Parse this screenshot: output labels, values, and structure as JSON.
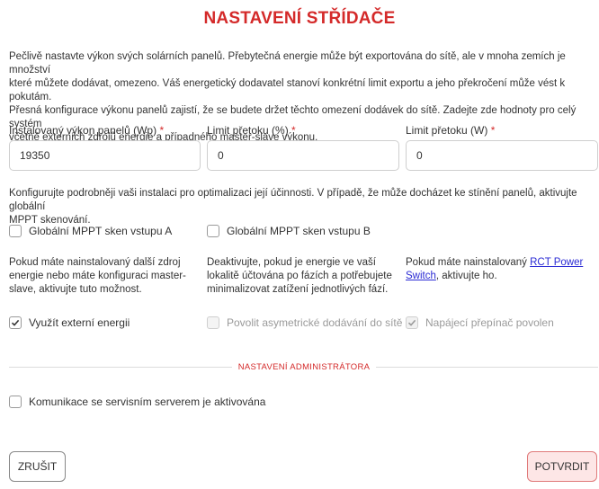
{
  "title": "NASTAVENÍ STŘÍDAČE",
  "intro": [
    "Pečlivě nastavte výkon svých solárních panelů. Přebytečná energie může být exportována do sítě, ale v mnoha zemích je množství",
    "které můžete dodávat, omezeno. Váš energetický dodavatel stanoví konkrétní limit exportu a jeho překročení může vést k pokutám.",
    "Přesná konfigurace výkonu panelů zajistí, že se budete držet těchto omezení dodávek do sítě. Zadejte zde hodnoty pro celý systém",
    "včetně externích zdrojů energie a případného master-slave výkonu."
  ],
  "fields": [
    {
      "label": "Instalovaný výkon panelů (Wp)",
      "required_mark": "*",
      "value": "19350"
    },
    {
      "label": "Limit přetoku (%)",
      "required_mark": "*",
      "value": "0"
    },
    {
      "label": "Limit přetoku (W)",
      "required_mark": "*",
      "value": "0"
    }
  ],
  "optimize_text": [
    "Konfigurujte podrobněji vaši instalaci pro optimalizaci její účinnosti. V případě, že může docházet ke stínění panelů, aktivujte globální",
    "MPPT skenování."
  ],
  "mppt": [
    {
      "label": "Globální MPPT sken vstupu A",
      "checked": false
    },
    {
      "label": "Globální MPPT sken vstupu B",
      "checked": false
    }
  ],
  "descriptions": {
    "external": [
      "Pokud máte nainstalovaný další zdroj",
      "energie nebo máte konfiguraci master-",
      "slave, aktivujte tuto možnost."
    ],
    "asym": [
      "Deaktivujte, pokud je energie ve vaší",
      "lokalitě účtována po fázích a potřebujete",
      "minimalizovat zatížení jednotlivých fází."
    ],
    "rct_prefix": "Pokud máte nainstalovaný ",
    "rct_link_1": "RCT Power",
    "rct_link_2": "Switch",
    "rct_suffix": ", aktivujte ho."
  },
  "options": [
    {
      "label": "Využít externí energii",
      "checked": true,
      "disabled": false
    },
    {
      "label": "Povolit asymetrické dodávání do sítě",
      "checked": false,
      "disabled": true
    },
    {
      "label": "Napájecí přepínač povolen",
      "checked": true,
      "disabled": true
    }
  ],
  "admin_section": "NASTAVENÍ ADMINISTRÁTORA",
  "service": {
    "label": "Komunikace se servisním serverem je aktivována",
    "checked": false
  },
  "buttons": {
    "cancel": "ZRUŠIT",
    "confirm": "POTVRDIT"
  },
  "colors": {
    "accent": "#d42a2a",
    "link": "#2a2ad4",
    "confirm_bg": "#fde6e6"
  }
}
